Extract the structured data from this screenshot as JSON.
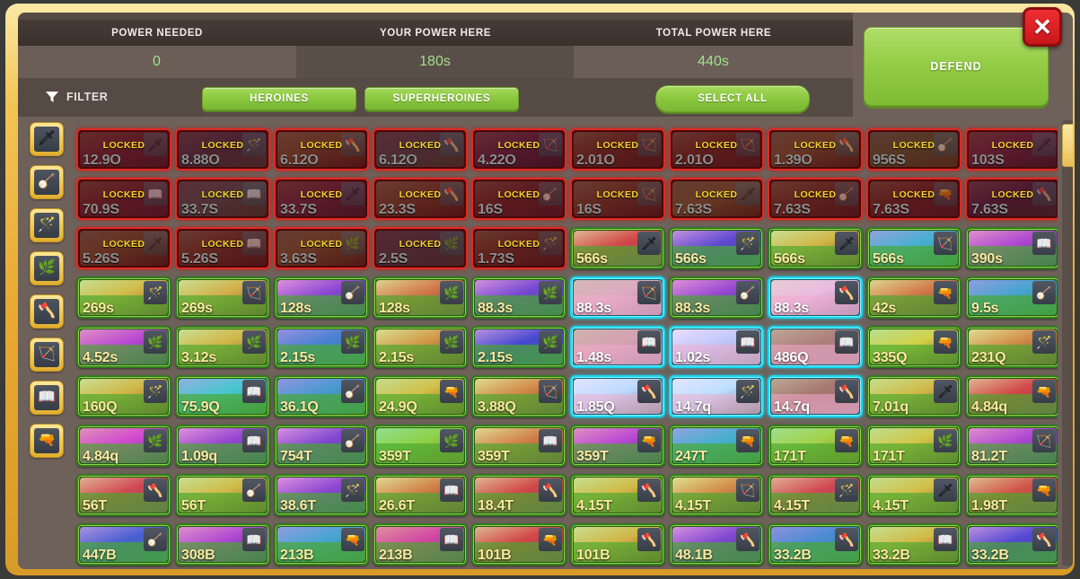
{
  "window": {
    "close_label": "✕"
  },
  "header": {
    "stats": [
      {
        "label": "POWER NEEDED",
        "value": "0"
      },
      {
        "label": "YOUR POWER HERE",
        "value": "180s"
      },
      {
        "label": "TOTAL POWER HERE",
        "value": "440s"
      }
    ],
    "accent_green": "#8cc93f",
    "value_color": "#9fe08a"
  },
  "filter": {
    "label": "FILTER",
    "buttons": [
      {
        "name": "heroines",
        "label": "HEROINES"
      },
      {
        "name": "superheroines",
        "label": "SUPERHEROINES"
      }
    ],
    "select_all_label": "SELECT ALL"
  },
  "defend": {
    "label": "DEFEND"
  },
  "sidebar": {
    "items": [
      {
        "name": "class-sword",
        "icon": "sword-icon",
        "glyph": "🗡"
      },
      {
        "name": "class-lute",
        "icon": "lute-icon",
        "glyph": "🪕"
      },
      {
        "name": "class-wand",
        "icon": "wand-icon",
        "glyph": "🪄"
      },
      {
        "name": "class-nature-bow",
        "icon": "nature-bow-icon",
        "glyph": "🌿"
      },
      {
        "name": "class-axe",
        "icon": "axe-icon",
        "glyph": "🪓"
      },
      {
        "name": "class-crossbow",
        "icon": "crossbow-icon",
        "glyph": "🏹"
      },
      {
        "name": "class-spellbook",
        "icon": "spellbook-icon",
        "glyph": "📖"
      },
      {
        "name": "class-rifle",
        "icon": "rifle-icon",
        "glyph": "🔫"
      }
    ]
  },
  "scrollbar": {
    "position": "top"
  },
  "grid": {
    "columns": 10,
    "rows": 10,
    "locked_label": "LOCKED",
    "cards": [
      {
        "value": "12.9O",
        "state": "locked",
        "weapon": "sword-icon",
        "glyph": "🗡",
        "hue": 330
      },
      {
        "value": "8.88O",
        "state": "locked",
        "weapon": "wand-icon",
        "glyph": "🪄",
        "hue": 220
      },
      {
        "value": "6.12O",
        "state": "locked",
        "weapon": "axe-icon",
        "glyph": "🪓",
        "hue": 40
      },
      {
        "value": "6.12O",
        "state": "locked",
        "weapon": "axe-icon",
        "glyph": "🪓",
        "hue": 200
      },
      {
        "value": "4.22O",
        "state": "locked",
        "weapon": "crossbow-icon",
        "glyph": "🏹",
        "hue": 280
      },
      {
        "value": "2.01O",
        "state": "locked",
        "weapon": "crossbow-icon",
        "glyph": "🏹",
        "hue": 10
      },
      {
        "value": "2.01O",
        "state": "locked",
        "weapon": "crossbow-icon",
        "glyph": "🏹",
        "hue": 5
      },
      {
        "value": "1.39O",
        "state": "locked",
        "weapon": "axe-icon",
        "glyph": "🪓",
        "hue": 50
      },
      {
        "value": "956S",
        "state": "locked",
        "weapon": "lute-icon",
        "glyph": "🪕",
        "hue": 110
      },
      {
        "value": "103S",
        "state": "locked",
        "weapon": "sword-icon",
        "glyph": "🗡",
        "hue": 300
      },
      {
        "value": "70.9S",
        "state": "locked",
        "weapon": "spellbook-icon",
        "glyph": "📖",
        "hue": 340
      },
      {
        "value": "33.7S",
        "state": "locked",
        "weapon": "spellbook-icon",
        "glyph": "📖",
        "hue": 190
      },
      {
        "value": "33.7S",
        "state": "locked",
        "weapon": "sword-icon",
        "glyph": "🗡",
        "hue": 310
      },
      {
        "value": "23.3S",
        "state": "locked",
        "weapon": "axe-icon",
        "glyph": "🪓",
        "hue": 30
      },
      {
        "value": "16S",
        "state": "locked",
        "weapon": "lute-icon",
        "glyph": "🪕",
        "hue": 350
      },
      {
        "value": "16S",
        "state": "locked",
        "weapon": "crossbow-icon",
        "glyph": "🏹",
        "hue": 25
      },
      {
        "value": "7.63S",
        "state": "locked",
        "weapon": "sword-icon",
        "glyph": "🗡",
        "hue": 60
      },
      {
        "value": "7.63S",
        "state": "locked",
        "weapon": "lute-icon",
        "glyph": "🪕",
        "hue": 15
      },
      {
        "value": "7.63S",
        "state": "locked",
        "weapon": "rifle-icon",
        "glyph": "🔫",
        "hue": 355
      },
      {
        "value": "7.63S",
        "state": "locked",
        "weapon": "axe-icon",
        "glyph": "🪓",
        "hue": 250
      },
      {
        "value": "5.26S",
        "state": "locked",
        "weapon": "sword-icon",
        "glyph": "🗡",
        "hue": 45
      },
      {
        "value": "5.26S",
        "state": "locked",
        "weapon": "spellbook-icon",
        "glyph": "📖",
        "hue": 20
      },
      {
        "value": "3.63S",
        "state": "locked",
        "weapon": "nature-bow-icon",
        "glyph": "🌿",
        "hue": 55
      },
      {
        "value": "2.5S",
        "state": "locked",
        "weapon": "nature-bow-icon",
        "glyph": "🌿",
        "hue": 210
      },
      {
        "value": "1.73S",
        "state": "locked",
        "weapon": "wand-icon",
        "glyph": "🪄",
        "hue": 15
      },
      {
        "value": "566s",
        "state": "unlocked",
        "weapon": "sword-icon",
        "glyph": "🗡",
        "hue": 0
      },
      {
        "value": "566s",
        "state": "unlocked",
        "weapon": "wand-icon",
        "glyph": "🪄",
        "hue": 250
      },
      {
        "value": "566s",
        "state": "unlocked",
        "weapon": "sword-icon",
        "glyph": "🗡",
        "hue": 48
      },
      {
        "value": "566s",
        "state": "unlocked",
        "weapon": "crossbow-icon",
        "glyph": "🏹",
        "hue": 195
      },
      {
        "value": "390s",
        "state": "unlocked",
        "weapon": "spellbook-icon",
        "glyph": "📖",
        "hue": 285
      },
      {
        "value": "269s",
        "state": "unlocked",
        "weapon": "wand-icon",
        "glyph": "🪄",
        "hue": 50
      },
      {
        "value": "269s",
        "state": "unlocked",
        "weapon": "crossbow-icon",
        "glyph": "🏹",
        "hue": 45
      },
      {
        "value": "128s",
        "state": "unlocked",
        "weapon": "lute-icon",
        "glyph": "🪕",
        "hue": 270
      },
      {
        "value": "128s",
        "state": "unlocked",
        "weapon": "nature-bow-icon",
        "glyph": "🌿",
        "hue": 20
      },
      {
        "value": "88.3s",
        "state": "unlocked",
        "weapon": "nature-bow-icon",
        "glyph": "🌿",
        "hue": 260
      },
      {
        "value": "88.3s",
        "state": "selected",
        "weapon": "crossbow-icon",
        "glyph": "🏹",
        "hue": 190
      },
      {
        "value": "88.3s",
        "state": "unlocked",
        "weapon": "lute-icon",
        "glyph": "🪕",
        "hue": 275
      },
      {
        "value": "88.3s",
        "state": "selected",
        "weapon": "axe-icon",
        "glyph": "🪓",
        "hue": 170
      },
      {
        "value": "42s",
        "state": "unlocked",
        "weapon": "rifle-icon",
        "glyph": "🔫",
        "hue": 22
      },
      {
        "value": "9.5s",
        "state": "unlocked",
        "weapon": "lute-icon",
        "glyph": "🪕",
        "hue": 200
      },
      {
        "value": "4.52s",
        "state": "unlocked",
        "weapon": "nature-bow-icon",
        "glyph": "🌿",
        "hue": 290
      },
      {
        "value": "3.12s",
        "state": "unlocked",
        "weapon": "nature-bow-icon",
        "glyph": "🌿",
        "hue": 48
      },
      {
        "value": "2.15s",
        "state": "unlocked",
        "weapon": "nature-bow-icon",
        "glyph": "🌿",
        "hue": 215
      },
      {
        "value": "2.15s",
        "state": "unlocked",
        "weapon": "nature-bow-icon",
        "glyph": "🌿",
        "hue": 35
      },
      {
        "value": "2.15s",
        "state": "unlocked",
        "weapon": "nature-bow-icon",
        "glyph": "🌿",
        "hue": 240
      },
      {
        "value": "1.48s",
        "state": "selected",
        "weapon": "spellbook-icon",
        "glyph": "📖",
        "hue": 195
      },
      {
        "value": "1.02s",
        "state": "selected",
        "weapon": "spellbook-icon",
        "glyph": "📖",
        "hue": 100
      },
      {
        "value": "486Q",
        "state": "selected",
        "weapon": "spellbook-icon",
        "glyph": "📖",
        "hue": 215
      },
      {
        "value": "335Q",
        "state": "unlocked",
        "weapon": "rifle-icon",
        "glyph": "🔫",
        "hue": 60
      },
      {
        "value": "231Q",
        "state": "unlocked",
        "weapon": "wand-icon",
        "glyph": "🪄",
        "hue": 30
      },
      {
        "value": "160Q",
        "state": "unlocked",
        "weapon": "wand-icon",
        "glyph": "🪄",
        "hue": 48
      },
      {
        "value": "75.9Q",
        "state": "unlocked",
        "weapon": "spellbook-icon",
        "glyph": "📖",
        "hue": 185
      },
      {
        "value": "36.1Q",
        "state": "unlocked",
        "weapon": "lute-icon",
        "glyph": "🪕",
        "hue": 205
      },
      {
        "value": "24.9Q",
        "state": "unlocked",
        "weapon": "rifle-icon",
        "glyph": "🔫",
        "hue": 52
      },
      {
        "value": "3.88Q",
        "state": "unlocked",
        "weapon": "crossbow-icon",
        "glyph": "🏹",
        "hue": 28
      },
      {
        "value": "1.85Q",
        "state": "selected",
        "weapon": "axe-icon",
        "glyph": "🪓",
        "hue": 75
      },
      {
        "value": "14.7q",
        "state": "selected",
        "weapon": "wand-icon",
        "glyph": "🪄",
        "hue": 70
      },
      {
        "value": "14.7q",
        "state": "selected",
        "weapon": "axe-icon",
        "glyph": "🪓",
        "hue": 220
      },
      {
        "value": "7.01q",
        "state": "unlocked",
        "weapon": "sword-icon",
        "glyph": "🗡",
        "hue": 50
      },
      {
        "value": "4.84q",
        "state": "unlocked",
        "weapon": "rifle-icon",
        "glyph": "🔫",
        "hue": 0
      },
      {
        "value": "4.84q",
        "state": "unlocked",
        "weapon": "nature-bow-icon",
        "glyph": "🌿",
        "hue": 300
      },
      {
        "value": "1.09q",
        "state": "unlocked",
        "weapon": "spellbook-icon",
        "glyph": "📖",
        "hue": 275
      },
      {
        "value": "754T",
        "state": "unlocked",
        "weapon": "lute-icon",
        "glyph": "🪕",
        "hue": 265
      },
      {
        "value": "359T",
        "state": "unlocked",
        "weapon": "nature-bow-icon",
        "glyph": "🌿",
        "hue": 90
      },
      {
        "value": "359T",
        "state": "unlocked",
        "weapon": "spellbook-icon",
        "glyph": "📖",
        "hue": 25
      },
      {
        "value": "359T",
        "state": "unlocked",
        "weapon": "rifle-icon",
        "glyph": "🔫",
        "hue": 290
      },
      {
        "value": "247T",
        "state": "unlocked",
        "weapon": "rifle-icon",
        "glyph": "🔫",
        "hue": 195
      },
      {
        "value": "171T",
        "state": "unlocked",
        "weapon": "rifle-icon",
        "glyph": "🔫",
        "hue": 80
      },
      {
        "value": "171T",
        "state": "unlocked",
        "weapon": "nature-bow-icon",
        "glyph": "🌿",
        "hue": 55
      },
      {
        "value": "81.2T",
        "state": "unlocked",
        "weapon": "crossbow-icon",
        "glyph": "🏹",
        "hue": 285
      },
      {
        "value": "56T",
        "state": "unlocked",
        "weapon": "axe-icon",
        "glyph": "🪓",
        "hue": 355
      },
      {
        "value": "56T",
        "state": "unlocked",
        "weapon": "lute-icon",
        "glyph": "🪕",
        "hue": 50
      },
      {
        "value": "38.6T",
        "state": "unlocked",
        "weapon": "wand-icon",
        "glyph": "🪄",
        "hue": 270
      },
      {
        "value": "26.6T",
        "state": "unlocked",
        "weapon": "spellbook-icon",
        "glyph": "📖",
        "hue": 25
      },
      {
        "value": "18.4T",
        "state": "unlocked",
        "weapon": "axe-icon",
        "glyph": "🪓",
        "hue": 0
      },
      {
        "value": "4.15T",
        "state": "unlocked",
        "weapon": "axe-icon",
        "glyph": "🪓",
        "hue": 50
      },
      {
        "value": "4.15T",
        "state": "unlocked",
        "weapon": "crossbow-icon",
        "glyph": "🏹",
        "hue": 30
      },
      {
        "value": "4.15T",
        "state": "unlocked",
        "weapon": "wand-icon",
        "glyph": "🪄",
        "hue": 355
      },
      {
        "value": "4.15T",
        "state": "unlocked",
        "weapon": "sword-icon",
        "glyph": "🗡",
        "hue": 52
      },
      {
        "value": "1.98T",
        "state": "unlocked",
        "weapon": "rifle-icon",
        "glyph": "🔫",
        "hue": 5
      },
      {
        "value": "447B",
        "state": "unlocked",
        "weapon": "lute-icon",
        "glyph": "🪕",
        "hue": 230
      },
      {
        "value": "308B",
        "state": "unlocked",
        "weapon": "spellbook-icon",
        "glyph": "📖",
        "hue": 285
      },
      {
        "value": "213B",
        "state": "unlocked",
        "weapon": "rifle-icon",
        "glyph": "🔫",
        "hue": 200
      },
      {
        "value": "213B",
        "state": "unlocked",
        "weapon": "spellbook-icon",
        "glyph": "📖",
        "hue": 320
      },
      {
        "value": "101B",
        "state": "unlocked",
        "weapon": "rifle-icon",
        "glyph": "🔫",
        "hue": 0
      },
      {
        "value": "101B",
        "state": "unlocked",
        "weapon": "axe-icon",
        "glyph": "🪓",
        "hue": 48
      },
      {
        "value": "48.1B",
        "state": "unlocked",
        "weapon": "axe-icon",
        "glyph": "🪓",
        "hue": 265
      },
      {
        "value": "33.2B",
        "state": "unlocked",
        "weapon": "axe-icon",
        "glyph": "🪓",
        "hue": 210
      },
      {
        "value": "33.2B",
        "state": "unlocked",
        "weapon": "spellbook-icon",
        "glyph": "📖",
        "hue": 50
      },
      {
        "value": "33.2B",
        "state": "unlocked",
        "weapon": "axe-icon",
        "glyph": "🪓",
        "hue": 245
      }
    ]
  }
}
